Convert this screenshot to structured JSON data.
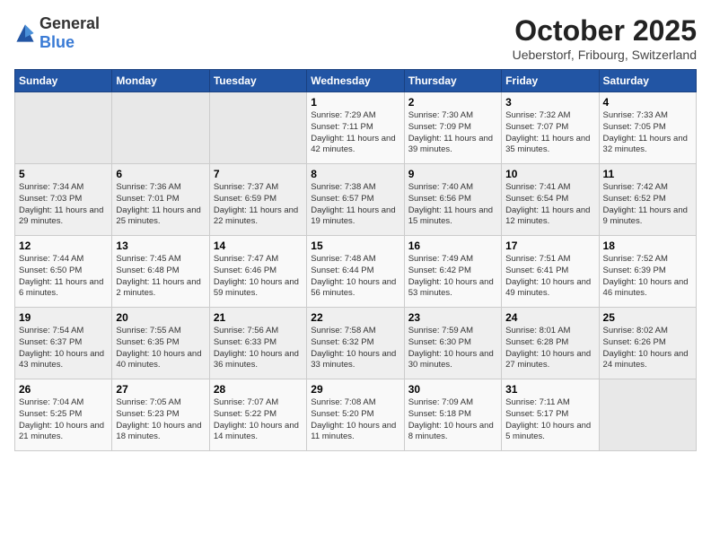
{
  "header": {
    "logo_general": "General",
    "logo_blue": "Blue",
    "month": "October 2025",
    "location": "Ueberstorf, Fribourg, Switzerland"
  },
  "days_of_week": [
    "Sunday",
    "Monday",
    "Tuesday",
    "Wednesday",
    "Thursday",
    "Friday",
    "Saturday"
  ],
  "weeks": [
    [
      {
        "day": "",
        "info": ""
      },
      {
        "day": "",
        "info": ""
      },
      {
        "day": "",
        "info": ""
      },
      {
        "day": "1",
        "info": "Sunrise: 7:29 AM\nSunset: 7:11 PM\nDaylight: 11 hours\nand 42 minutes."
      },
      {
        "day": "2",
        "info": "Sunrise: 7:30 AM\nSunset: 7:09 PM\nDaylight: 11 hours\nand 39 minutes."
      },
      {
        "day": "3",
        "info": "Sunrise: 7:32 AM\nSunset: 7:07 PM\nDaylight: 11 hours\nand 35 minutes."
      },
      {
        "day": "4",
        "info": "Sunrise: 7:33 AM\nSunset: 7:05 PM\nDaylight: 11 hours\nand 32 minutes."
      }
    ],
    [
      {
        "day": "5",
        "info": "Sunrise: 7:34 AM\nSunset: 7:03 PM\nDaylight: 11 hours\nand 29 minutes."
      },
      {
        "day": "6",
        "info": "Sunrise: 7:36 AM\nSunset: 7:01 PM\nDaylight: 11 hours\nand 25 minutes."
      },
      {
        "day": "7",
        "info": "Sunrise: 7:37 AM\nSunset: 6:59 PM\nDaylight: 11 hours\nand 22 minutes."
      },
      {
        "day": "8",
        "info": "Sunrise: 7:38 AM\nSunset: 6:57 PM\nDaylight: 11 hours\nand 19 minutes."
      },
      {
        "day": "9",
        "info": "Sunrise: 7:40 AM\nSunset: 6:56 PM\nDaylight: 11 hours\nand 15 minutes."
      },
      {
        "day": "10",
        "info": "Sunrise: 7:41 AM\nSunset: 6:54 PM\nDaylight: 11 hours\nand 12 minutes."
      },
      {
        "day": "11",
        "info": "Sunrise: 7:42 AM\nSunset: 6:52 PM\nDaylight: 11 hours\nand 9 minutes."
      }
    ],
    [
      {
        "day": "12",
        "info": "Sunrise: 7:44 AM\nSunset: 6:50 PM\nDaylight: 11 hours\nand 6 minutes."
      },
      {
        "day": "13",
        "info": "Sunrise: 7:45 AM\nSunset: 6:48 PM\nDaylight: 11 hours\nand 2 minutes."
      },
      {
        "day": "14",
        "info": "Sunrise: 7:47 AM\nSunset: 6:46 PM\nDaylight: 10 hours\nand 59 minutes."
      },
      {
        "day": "15",
        "info": "Sunrise: 7:48 AM\nSunset: 6:44 PM\nDaylight: 10 hours\nand 56 minutes."
      },
      {
        "day": "16",
        "info": "Sunrise: 7:49 AM\nSunset: 6:42 PM\nDaylight: 10 hours\nand 53 minutes."
      },
      {
        "day": "17",
        "info": "Sunrise: 7:51 AM\nSunset: 6:41 PM\nDaylight: 10 hours\nand 49 minutes."
      },
      {
        "day": "18",
        "info": "Sunrise: 7:52 AM\nSunset: 6:39 PM\nDaylight: 10 hours\nand 46 minutes."
      }
    ],
    [
      {
        "day": "19",
        "info": "Sunrise: 7:54 AM\nSunset: 6:37 PM\nDaylight: 10 hours\nand 43 minutes."
      },
      {
        "day": "20",
        "info": "Sunrise: 7:55 AM\nSunset: 6:35 PM\nDaylight: 10 hours\nand 40 minutes."
      },
      {
        "day": "21",
        "info": "Sunrise: 7:56 AM\nSunset: 6:33 PM\nDaylight: 10 hours\nand 36 minutes."
      },
      {
        "day": "22",
        "info": "Sunrise: 7:58 AM\nSunset: 6:32 PM\nDaylight: 10 hours\nand 33 minutes."
      },
      {
        "day": "23",
        "info": "Sunrise: 7:59 AM\nSunset: 6:30 PM\nDaylight: 10 hours\nand 30 minutes."
      },
      {
        "day": "24",
        "info": "Sunrise: 8:01 AM\nSunset: 6:28 PM\nDaylight: 10 hours\nand 27 minutes."
      },
      {
        "day": "25",
        "info": "Sunrise: 8:02 AM\nSunset: 6:26 PM\nDaylight: 10 hours\nand 24 minutes."
      }
    ],
    [
      {
        "day": "26",
        "info": "Sunrise: 7:04 AM\nSunset: 5:25 PM\nDaylight: 10 hours\nand 21 minutes."
      },
      {
        "day": "27",
        "info": "Sunrise: 7:05 AM\nSunset: 5:23 PM\nDaylight: 10 hours\nand 18 minutes."
      },
      {
        "day": "28",
        "info": "Sunrise: 7:07 AM\nSunset: 5:22 PM\nDaylight: 10 hours\nand 14 minutes."
      },
      {
        "day": "29",
        "info": "Sunrise: 7:08 AM\nSunset: 5:20 PM\nDaylight: 10 hours\nand 11 minutes."
      },
      {
        "day": "30",
        "info": "Sunrise: 7:09 AM\nSunset: 5:18 PM\nDaylight: 10 hours\nand 8 minutes."
      },
      {
        "day": "31",
        "info": "Sunrise: 7:11 AM\nSunset: 5:17 PM\nDaylight: 10 hours\nand 5 minutes."
      },
      {
        "day": "",
        "info": ""
      }
    ]
  ]
}
